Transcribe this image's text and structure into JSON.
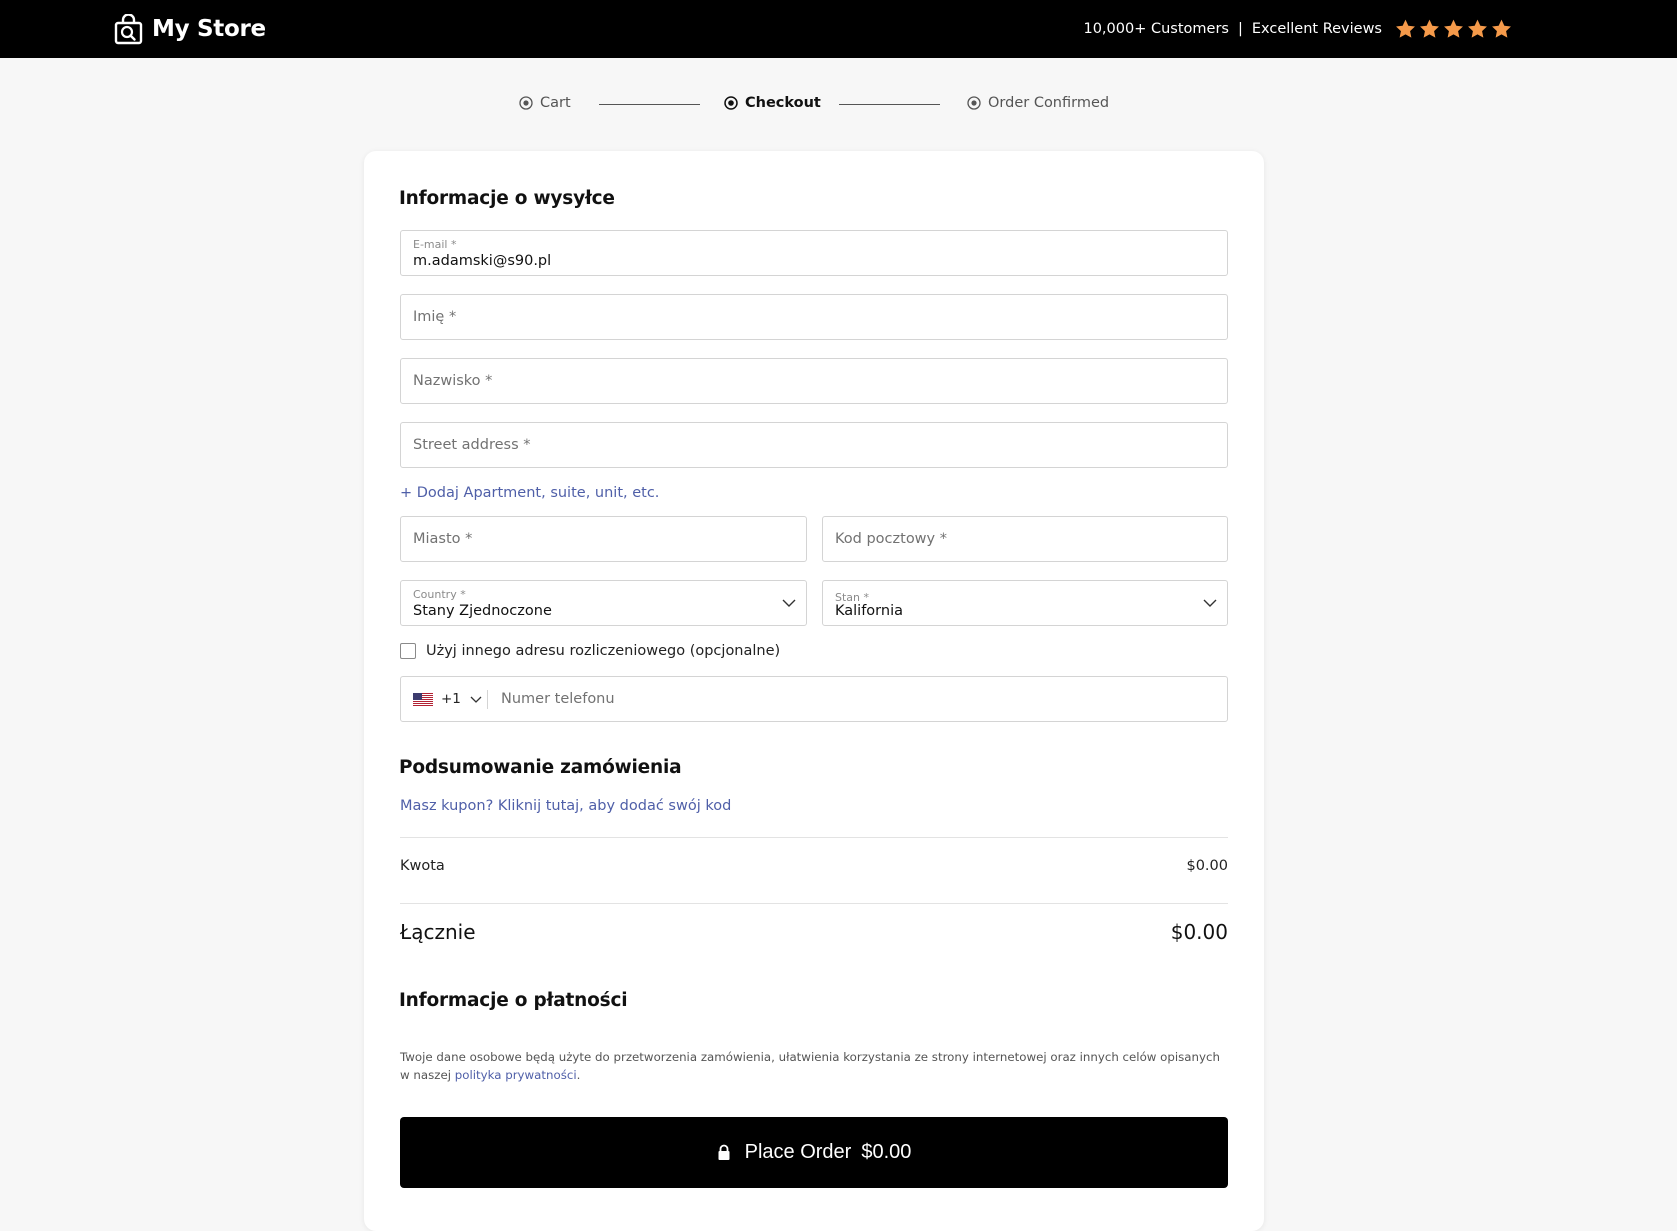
{
  "header": {
    "logo_text": "My Store",
    "customers": "10,000+ Customers",
    "separator": "|",
    "reviews": "Excellent Reviews",
    "rating_stars": 5,
    "star_color": "#f59a4a"
  },
  "steps": [
    {
      "label": "Cart",
      "state": "done"
    },
    {
      "label": "Checkout",
      "state": "active"
    },
    {
      "label": "Order Confirmed",
      "state": "pending"
    }
  ],
  "shipping": {
    "title": "Informacje o wysyłce",
    "email": {
      "label": "E-mail *",
      "value": "m.adamski@s90.pl"
    },
    "first_name": {
      "placeholder": "Imię *"
    },
    "last_name": {
      "placeholder": "Nazwisko *"
    },
    "street": {
      "placeholder": "Street address *"
    },
    "add_apartment": "+ Dodaj Apartment, suite, unit, etc.",
    "city": {
      "placeholder": "Miasto *"
    },
    "postcode": {
      "placeholder": "Kod pocztowy *"
    },
    "country": {
      "label": "Country *",
      "value": "Stany Zjednoczone"
    },
    "state": {
      "label": "Stan *",
      "value": "Kalifornia"
    },
    "billing_checkbox": "Użyj innego adresu rozliczeniowego (opcjonalne)",
    "phone": {
      "country_code": "+1",
      "placeholder": "Numer telefonu"
    }
  },
  "summary": {
    "title": "Podsumowanie zamówienia",
    "coupon_link": "Masz kupon? Kliknij tutaj, aby dodać swój kod",
    "amount_label": "Kwota",
    "amount_value": "$0.00",
    "total_label": "Łącznie",
    "total_value": "$0.00"
  },
  "payment": {
    "title": "Informacje o płatności",
    "privacy_text": "Twoje dane osobowe będą użyte do przetworzenia zamówienia, ułatwienia korzystania ze strony internetowej oraz innych celów opisanych w naszej ",
    "privacy_link": "polityka prywatności",
    "privacy_end": "."
  },
  "place_order": {
    "label": "Place Order",
    "amount": "$0.00"
  }
}
